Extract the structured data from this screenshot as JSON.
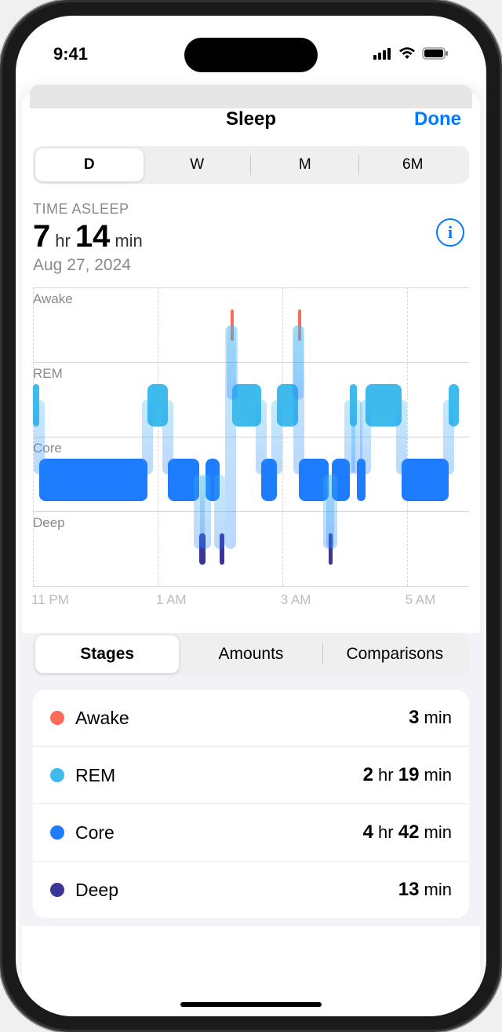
{
  "status": {
    "time": "9:41"
  },
  "nav": {
    "title": "Sleep",
    "done": "Done"
  },
  "periods": {
    "items": [
      {
        "label": "D",
        "active": true
      },
      {
        "label": "W",
        "active": false
      },
      {
        "label": "M",
        "active": false
      },
      {
        "label": "6M",
        "active": false
      }
    ]
  },
  "summary": {
    "label": "TIME ASLEEP",
    "hours": "7",
    "hr_unit": "hr",
    "minutes": "14",
    "min_unit": "min",
    "date": "Aug 27, 2024"
  },
  "chart_data": {
    "type": "sleep-hypnogram",
    "y_categories": [
      "Awake",
      "REM",
      "Core",
      "Deep"
    ],
    "x_ticks": [
      "11 PM",
      "1 AM",
      "3 AM",
      "5 AM"
    ],
    "x_range_hours": [
      "23:00",
      "06:00"
    ],
    "segments": [
      {
        "stage": "REM",
        "start": "23:00",
        "end": "23:06"
      },
      {
        "stage": "Core",
        "start": "23:06",
        "end": "00:50"
      },
      {
        "stage": "REM",
        "start": "00:50",
        "end": "01:10"
      },
      {
        "stage": "Core",
        "start": "01:10",
        "end": "01:40"
      },
      {
        "stage": "Deep",
        "start": "01:40",
        "end": "01:46"
      },
      {
        "stage": "Core",
        "start": "01:46",
        "end": "02:00"
      },
      {
        "stage": "Deep",
        "start": "02:00",
        "end": "02:04"
      },
      {
        "stage": "Awake",
        "start": "02:10",
        "end": "02:12"
      },
      {
        "stage": "REM",
        "start": "02:12",
        "end": "02:40"
      },
      {
        "stage": "Core",
        "start": "02:40",
        "end": "02:55"
      },
      {
        "stage": "REM",
        "start": "02:55",
        "end": "03:15"
      },
      {
        "stage": "Awake",
        "start": "03:15",
        "end": "03:16"
      },
      {
        "stage": "Core",
        "start": "03:16",
        "end": "03:45"
      },
      {
        "stage": "Deep",
        "start": "03:45",
        "end": "03:48"
      },
      {
        "stage": "Core",
        "start": "03:48",
        "end": "04:05"
      },
      {
        "stage": "REM",
        "start": "04:05",
        "end": "04:12"
      },
      {
        "stage": "Core",
        "start": "04:12",
        "end": "04:20"
      },
      {
        "stage": "REM",
        "start": "04:20",
        "end": "04:55"
      },
      {
        "stage": "Core",
        "start": "04:55",
        "end": "05:40"
      },
      {
        "stage": "REM",
        "start": "05:40",
        "end": "05:50"
      }
    ],
    "colors": {
      "Awake": "#ff6b5b",
      "REM": "#3ebaed",
      "Core": "#1e7cff",
      "Deep": "#3b3499"
    }
  },
  "subtabs": {
    "items": [
      {
        "label": "Stages",
        "active": true
      },
      {
        "label": "Amounts",
        "active": false
      },
      {
        "label": "Comparisons",
        "active": false
      }
    ]
  },
  "stages": [
    {
      "name": "Awake",
      "color": "#ff6b5b",
      "value_html": "<b>3</b> min"
    },
    {
      "name": "REM",
      "color": "#3ebaed",
      "value_html": "<b>2</b> hr <b>19</b> min"
    },
    {
      "name": "Core",
      "color": "#1e7cff",
      "value_html": "<b>4</b> hr <b>42</b> min"
    },
    {
      "name": "Deep",
      "color": "#3b3499",
      "value_html": "<b>13</b> min"
    }
  ]
}
